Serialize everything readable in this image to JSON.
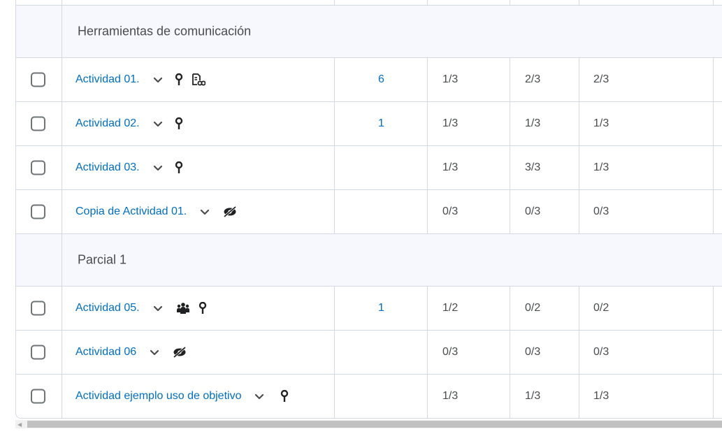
{
  "sections": [
    {
      "title": "Herramientas de comunicación"
    },
    {
      "title": "Parcial 1"
    }
  ],
  "rows": [
    {
      "name": "Actividad 01.",
      "count": "6",
      "c1": "1/3",
      "c2": "2/3",
      "c3": "2/3"
    },
    {
      "name": "Actividad 02.",
      "count": "1",
      "c1": "1/3",
      "c2": "1/3",
      "c3": "1/3"
    },
    {
      "name": "Actividad 03.",
      "count": "",
      "c1": "1/3",
      "c2": "3/3",
      "c3": "1/3"
    },
    {
      "name": "Copia de Actividad 01.",
      "count": "",
      "c1": "0/3",
      "c2": "0/3",
      "c3": "0/3"
    },
    {
      "name": "Actividad 05.",
      "count": "1",
      "c1": "1/2",
      "c2": "0/2",
      "c3": "0/2"
    },
    {
      "name": "Actividad 06",
      "count": "",
      "c1": "0/3",
      "c2": "0/3",
      "c3": "0/3"
    },
    {
      "name": "Actividad ejemplo uso de objetivo",
      "count": "",
      "c1": "1/3",
      "c2": "1/3",
      "c3": "1/3"
    }
  ],
  "icons": {
    "row0": [
      "objective-icon",
      "release-conditions-icon"
    ],
    "row1": [
      "objective-icon"
    ],
    "row2": [
      "objective-icon"
    ],
    "row3": [
      "hidden-icon"
    ],
    "row4": [
      "group-icon",
      "objective-icon"
    ],
    "row5": [
      "hidden-icon"
    ],
    "row6": [
      "objective-icon"
    ]
  },
  "colors": {
    "link": "#006fbf",
    "text": "#494c4e",
    "border": "#d3d9e3",
    "section_bg": "#f6f8fd"
  }
}
